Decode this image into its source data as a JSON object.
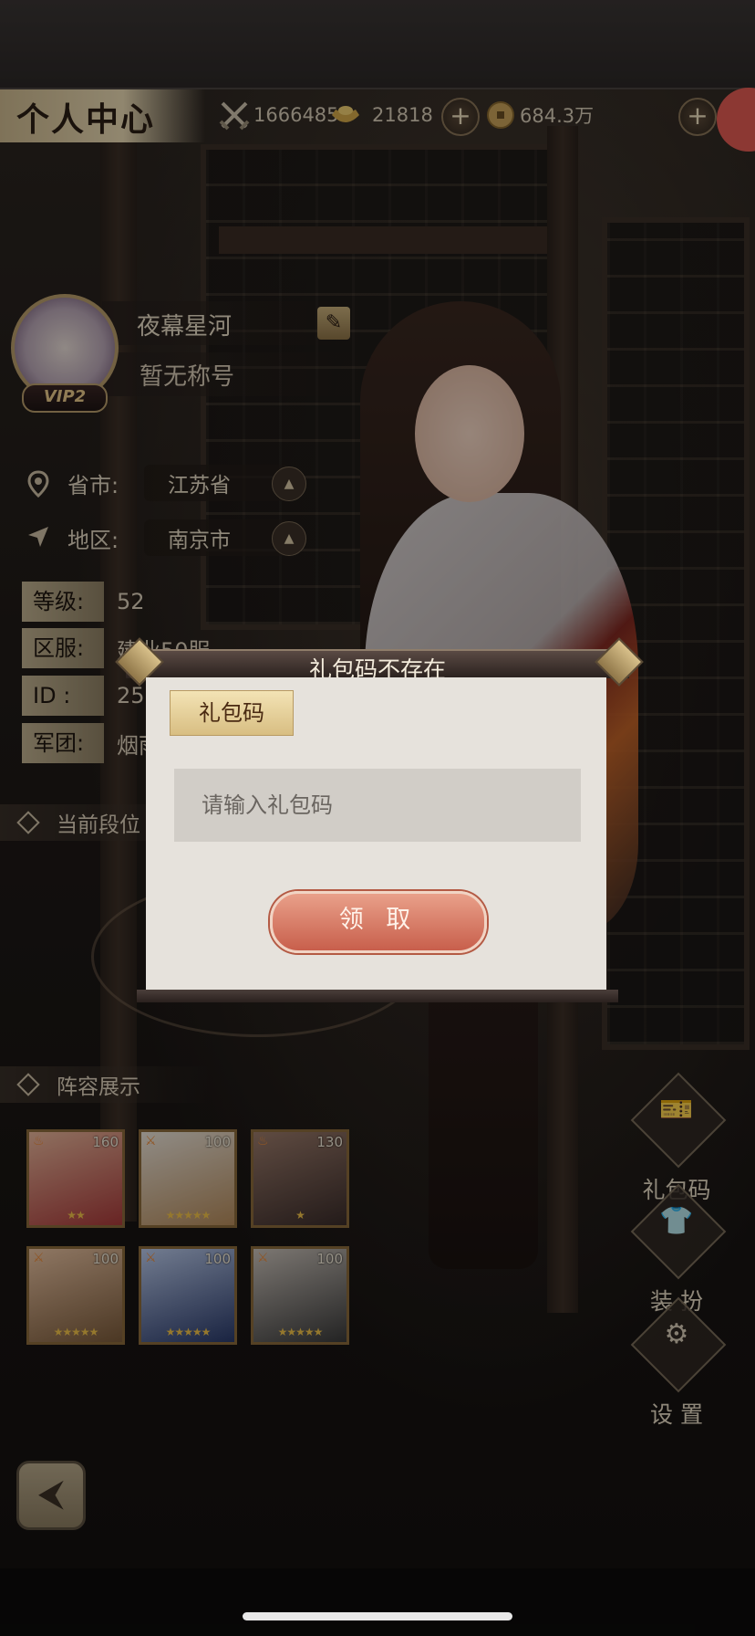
{
  "header": {
    "title": "个人中心",
    "resources": [
      {
        "icon": "crossed-swords-icon",
        "value": "1666485"
      },
      {
        "icon": "gold-ingot-icon",
        "value": "21818"
      },
      {
        "icon": "copper-coin-icon",
        "value": "684.3万"
      }
    ]
  },
  "profile": {
    "name": "夜幕星河",
    "title": "暂无称号",
    "vip": "VIP2",
    "province_label": "省市:",
    "province": "江苏省",
    "region_label": "地区:",
    "region": "南京市",
    "info": [
      {
        "label": "等级:",
        "value": "52"
      },
      {
        "label": "区服:",
        "value": "建业50服"
      },
      {
        "label": "ID  :",
        "value": "25"
      },
      {
        "label": "军团:",
        "value": "烟雨"
      }
    ]
  },
  "sections": {
    "rank": "当前段位",
    "lineup": "阵容展示"
  },
  "heroes": [
    {
      "level": "160",
      "stars": "★★",
      "colors": [
        "#a83a3a",
        "#e6b59a"
      ]
    },
    {
      "level": "100",
      "stars": "★★★★★",
      "colors": [
        "#b48a5a",
        "#e9e2d8"
      ]
    },
    {
      "level": "130",
      "stars": "★",
      "colors": [
        "#3a2c2a",
        "#9a7a6a"
      ]
    },
    {
      "level": "100",
      "stars": "★★★★★",
      "colors": [
        "#7a5a3a",
        "#e6c0a0"
      ]
    },
    {
      "level": "100",
      "stars": "★★★★★",
      "colors": [
        "#2a3a6a",
        "#b8c8e8"
      ]
    },
    {
      "level": "100",
      "stars": "★★★★★",
      "colors": [
        "#3a3a3a",
        "#c8c0b8"
      ]
    }
  ],
  "side_buttons": [
    {
      "label": "礼包码",
      "icon": "gift-ticket-icon"
    },
    {
      "label": "装 扮",
      "icon": "outfit-icon"
    },
    {
      "label": "设 置",
      "icon": "gear-icon"
    }
  ],
  "dialog": {
    "title": "礼包码不存在",
    "tab": "礼包码",
    "input_placeholder": "请输入礼包码",
    "claim_label": "领 取"
  }
}
